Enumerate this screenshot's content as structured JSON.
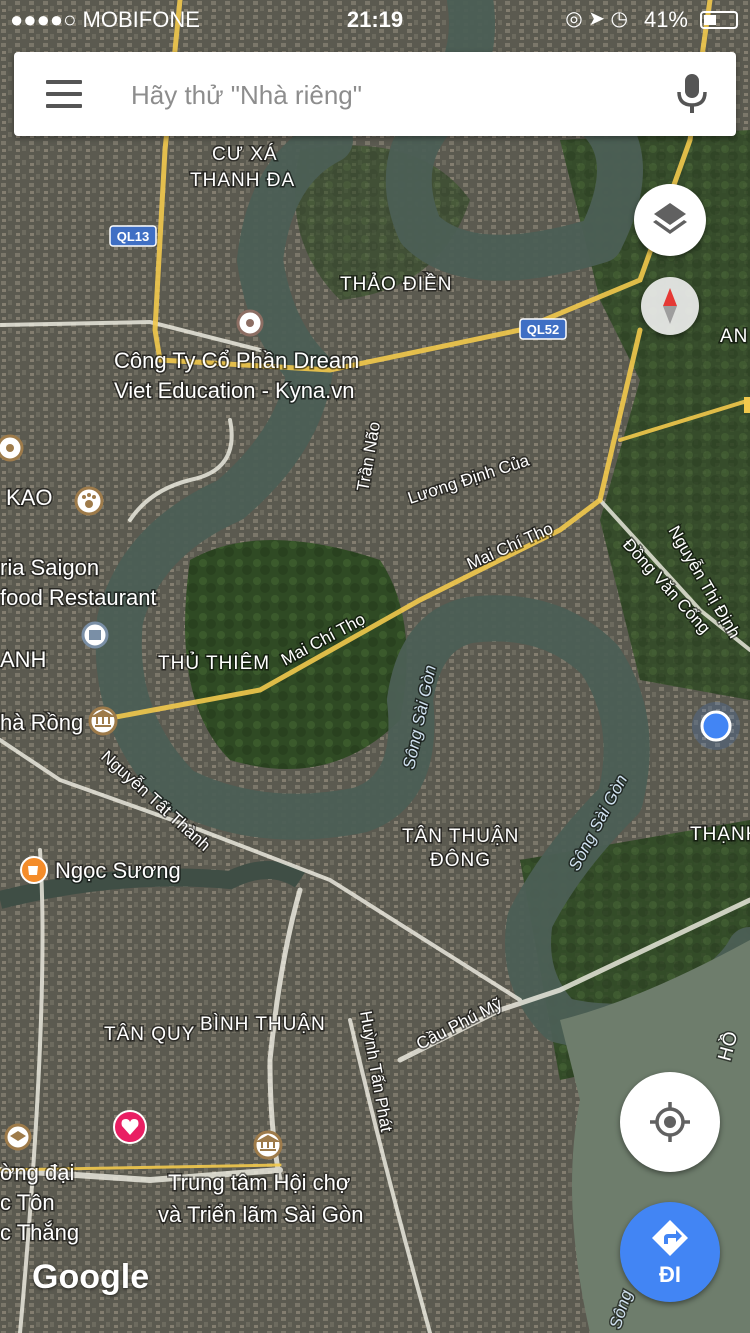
{
  "status_bar": {
    "carrier": "●●●●○ MOBIFONE",
    "time": "21:19",
    "battery": "41%",
    "battery_level": 0.41
  },
  "search": {
    "placeholder": "Hãy thử \"Nhà riêng\"",
    "menu_icon": "hamburger-menu-icon",
    "mic_icon": "microphone-icon"
  },
  "controls": {
    "layers_icon": "layers-icon",
    "compass_icon": "compass-icon",
    "locate_icon": "my-location-icon",
    "go_icon": "directions-icon",
    "go_label": "ĐI"
  },
  "map": {
    "attribution": "Google",
    "colors": {
      "road": "#f3f1e6",
      "highway": "#f2c94c",
      "river": "#4c5f55",
      "shield": "#3f6fc4",
      "location": "#4285f4"
    },
    "area_labels": {
      "cu_xa": "CƯ XÁ",
      "thanh_da": "THANH ĐA",
      "thao_dien": "THẢO ĐIỀN",
      "an": "AN",
      "kao": "KAO",
      "anh": "ANH",
      "thu_thiem": "THỦ THIÊM",
      "tan_thuan": "TÂN THUẬN",
      "dong": "ĐÔNG",
      "thanh": "THẠNH",
      "tan_quy": "TÂN QUY",
      "binh_thuan": "BÌNH THUẬN",
      "ho": "HỒ"
    },
    "road_labels": {
      "tran_nao": "Trần Não",
      "luong_dinh_cua": "Lương Định Của",
      "mai_chi_tho_1": "Mai Chí Thọ",
      "mai_chi_tho_2": "Mai Chí Thọ",
      "dong_van_cong": "Đồng Văn Cống",
      "nguyen_thi_dinh": "Nguyễn Thị Định",
      "nguyen_tat_thanh": "Nguyễn Tất Thành",
      "cau_phu_my": "Cầu Phú Mỹ",
      "huynh_tan_phat": "Huỳnh Tấn Phát"
    },
    "water_labels": {
      "song_sai_gon_1": "Sông Sài Gòn",
      "song_sai_gon_2": "Sông Sài Gòn",
      "song_bottom": "Sông"
    },
    "route_shields": {
      "ql13": "QL13",
      "ql52": "QL52"
    },
    "pois": {
      "dream_line1": "Công Ty Cổ Phần Dream",
      "dream_line2": "Viet Education - Kyna.vn",
      "saigon_line1": "ria Saigon",
      "saigon_line2": "food Restaurant",
      "nha_rong": "hà Rồng",
      "ngoc_suong": "Ngọc Sương",
      "hoi_cho_line1": "Trung tâm Hội chợ",
      "hoi_cho_line2": "và Triển lãm Sài Gòn",
      "left_line1": "ờng đại",
      "left_line2": "c Tôn",
      "left_line3": "c Thắng"
    }
  }
}
